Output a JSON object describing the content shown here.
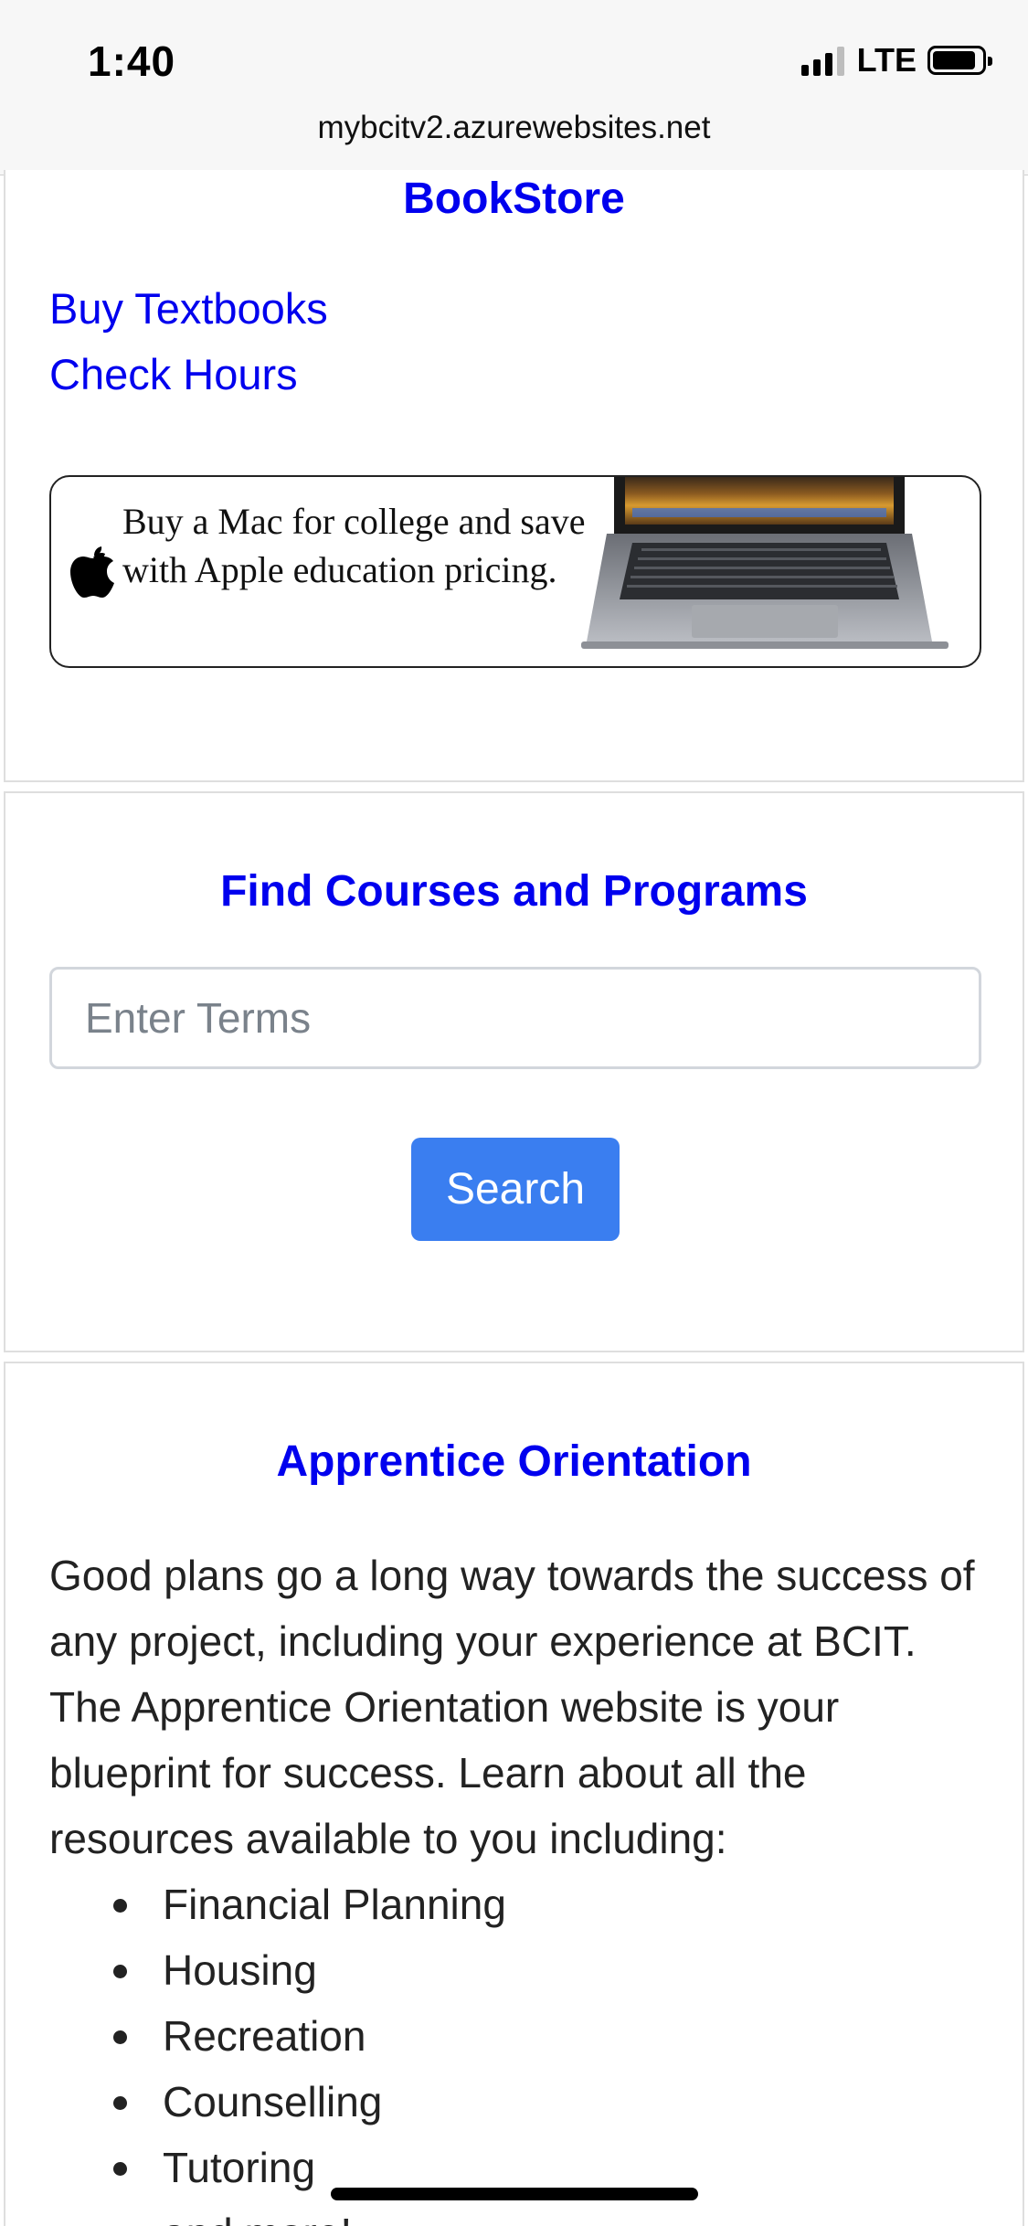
{
  "status_bar": {
    "time": "1:40",
    "network": "LTE",
    "signal_bars_active": 3,
    "signal_bars_total": 4,
    "battery_fill_fraction": 0.78
  },
  "browser": {
    "url": "mybcitv2.azurewebsites.net"
  },
  "bookstore": {
    "title": "BookStore",
    "links": [
      "Buy Textbooks",
      "Check Hours"
    ],
    "ad": {
      "text": "Buy a Mac for college and save with Apple education pricing.",
      "icon": "apple-logo-icon",
      "image": "macbook-laptop-image"
    }
  },
  "courses": {
    "title": "Find Courses and Programs",
    "search_placeholder": "Enter Terms",
    "search_value": "",
    "button_label": "Search"
  },
  "orientation": {
    "title": "Apprentice Orientation",
    "paragraph": "Good plans go a long way towards the success of any project, including your experience at BCIT. The Apprentice Orientation website is your blueprint for success. Learn about all the resources available to you including:",
    "items": [
      "Financial Planning",
      "Housing",
      "Recreation",
      "Counselling",
      "Tutoring",
      "and more!"
    ]
  },
  "colors": {
    "link": "#0000ee",
    "button": "#3a7ef0",
    "text": "#222222",
    "topbar": "#f7f7f7"
  }
}
